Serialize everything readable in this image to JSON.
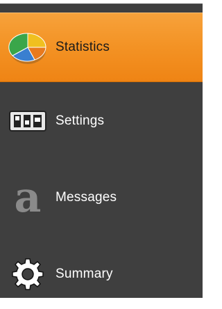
{
  "nav": {
    "items": [
      {
        "label": "Statistics",
        "icon": "pie-chart-icon",
        "active": true
      },
      {
        "label": "Settings",
        "icon": "sliders-panel-icon",
        "active": false
      },
      {
        "label": "Messages",
        "icon": "letter-a-icon",
        "active": false
      },
      {
        "label": "Summary",
        "icon": "gear-icon",
        "active": false
      }
    ]
  },
  "colors": {
    "active_bg": "#f39224",
    "panel_bg": "#3f3f3f",
    "active_text": "#1a1a1a",
    "text": "#ffffff"
  }
}
